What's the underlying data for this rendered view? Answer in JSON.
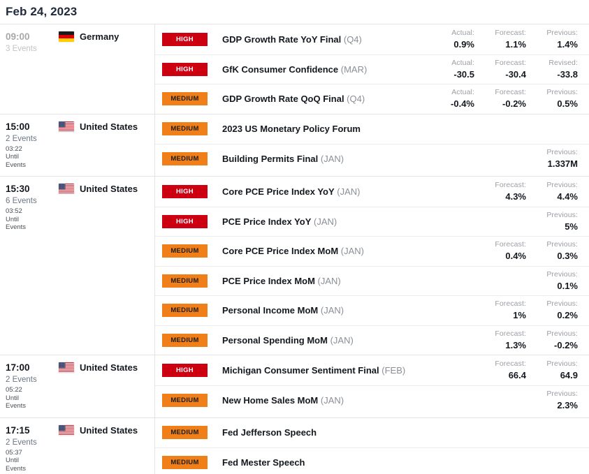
{
  "header": {
    "date_title": "Feb 24, 2023"
  },
  "colors": {
    "impact_high": "#cc0011",
    "impact_medium": "#f07f1a",
    "title": "#1f2a3c",
    "muted": "#9a9ea4"
  },
  "labels": {
    "actual": "Actual:",
    "forecast": "Forecast:",
    "previous": "Previous:",
    "revised": "Revised:",
    "until": "Until",
    "events_word": "Events"
  },
  "blocks": [
    {
      "time": "09:00",
      "events_count": "3 Events",
      "countdown": "",
      "past": true,
      "country": "Germany",
      "flag": "flag-germany",
      "rows": [
        {
          "impact": "HIGH",
          "impact_level": "high",
          "title": "GDP Growth Rate YoY Final",
          "period": "(Q4)",
          "cells": [
            {
              "label": "Actual:",
              "value": "0.9%"
            },
            {
              "label": "Forecast:",
              "value": "1.1%"
            },
            {
              "label": "Previous:",
              "value": "1.4%"
            }
          ]
        },
        {
          "impact": "HIGH",
          "impact_level": "high",
          "title": "GfK Consumer Confidence",
          "period": "(MAR)",
          "cells": [
            {
              "label": "Actual:",
              "value": "-30.5"
            },
            {
              "label": "Forecast:",
              "value": "-30.4"
            },
            {
              "label": "Revised:",
              "value": "-33.8"
            }
          ]
        },
        {
          "impact": "MEDIUM",
          "impact_level": "medium",
          "title": "GDP Growth Rate QoQ Final",
          "period": "(Q4)",
          "cells": [
            {
              "label": "Actual:",
              "value": "-0.4%"
            },
            {
              "label": "Forecast:",
              "value": "-0.2%"
            },
            {
              "label": "Previous:",
              "value": "0.5%"
            }
          ]
        }
      ]
    },
    {
      "time": "15:00",
      "events_count": "2 Events",
      "countdown": "03:22",
      "past": false,
      "country": "United States",
      "flag": "flag-united-states",
      "rows": [
        {
          "impact": "MEDIUM",
          "impact_level": "medium",
          "title": "2023 US Monetary Policy Forum",
          "period": "",
          "cells": [
            {
              "label": "",
              "value": ""
            },
            {
              "label": "",
              "value": ""
            },
            {
              "label": "",
              "value": ""
            }
          ]
        },
        {
          "impact": "MEDIUM",
          "impact_level": "medium",
          "title": "Building Permits Final",
          "period": "(JAN)",
          "cells": [
            {
              "label": "",
              "value": ""
            },
            {
              "label": "",
              "value": ""
            },
            {
              "label": "Previous:",
              "value": "1.337M"
            }
          ]
        }
      ]
    },
    {
      "time": "15:30",
      "events_count": "6 Events",
      "countdown": "03:52",
      "past": false,
      "country": "United States",
      "flag": "flag-united-states",
      "rows": [
        {
          "impact": "HIGH",
          "impact_level": "high",
          "title": "Core PCE Price Index YoY",
          "period": "(JAN)",
          "cells": [
            {
              "label": "",
              "value": ""
            },
            {
              "label": "Forecast:",
              "value": "4.3%"
            },
            {
              "label": "Previous:",
              "value": "4.4%"
            }
          ]
        },
        {
          "impact": "HIGH",
          "impact_level": "high",
          "title": "PCE Price Index YoY",
          "period": "(JAN)",
          "cells": [
            {
              "label": "",
              "value": ""
            },
            {
              "label": "",
              "value": ""
            },
            {
              "label": "Previous:",
              "value": "5%"
            }
          ]
        },
        {
          "impact": "MEDIUM",
          "impact_level": "medium",
          "title": "Core PCE Price Index MoM",
          "period": "(JAN)",
          "cells": [
            {
              "label": "",
              "value": ""
            },
            {
              "label": "Forecast:",
              "value": "0.4%"
            },
            {
              "label": "Previous:",
              "value": "0.3%"
            }
          ]
        },
        {
          "impact": "MEDIUM",
          "impact_level": "medium",
          "title": "PCE Price Index MoM",
          "period": "(JAN)",
          "cells": [
            {
              "label": "",
              "value": ""
            },
            {
              "label": "",
              "value": ""
            },
            {
              "label": "Previous:",
              "value": "0.1%"
            }
          ]
        },
        {
          "impact": "MEDIUM",
          "impact_level": "medium",
          "title": "Personal Income MoM",
          "period": "(JAN)",
          "cells": [
            {
              "label": "",
              "value": ""
            },
            {
              "label": "Forecast:",
              "value": "1%"
            },
            {
              "label": "Previous:",
              "value": "0.2%"
            }
          ]
        },
        {
          "impact": "MEDIUM",
          "impact_level": "medium",
          "title": "Personal Spending MoM",
          "period": "(JAN)",
          "cells": [
            {
              "label": "",
              "value": ""
            },
            {
              "label": "Forecast:",
              "value": "1.3%"
            },
            {
              "label": "Previous:",
              "value": "-0.2%"
            }
          ]
        }
      ]
    },
    {
      "time": "17:00",
      "events_count": "2 Events",
      "countdown": "05:22",
      "past": false,
      "country": "United States",
      "flag": "flag-united-states",
      "rows": [
        {
          "impact": "HIGH",
          "impact_level": "high",
          "title": "Michigan Consumer Sentiment Final",
          "period": "(FEB)",
          "cells": [
            {
              "label": "",
              "value": ""
            },
            {
              "label": "Forecast:",
              "value": "66.4"
            },
            {
              "label": "Previous:",
              "value": "64.9"
            }
          ]
        },
        {
          "impact": "MEDIUM",
          "impact_level": "medium",
          "title": "New Home Sales MoM",
          "period": "(JAN)",
          "cells": [
            {
              "label": "",
              "value": ""
            },
            {
              "label": "",
              "value": ""
            },
            {
              "label": "Previous:",
              "value": "2.3%"
            }
          ]
        }
      ]
    },
    {
      "time": "17:15",
      "events_count": "2 Events",
      "countdown": "05:37",
      "past": false,
      "country": "United States",
      "flag": "flag-united-states",
      "rows": [
        {
          "impact": "MEDIUM",
          "impact_level": "medium",
          "title": "Fed Jefferson Speech",
          "period": "",
          "cells": [
            {
              "label": "",
              "value": ""
            },
            {
              "label": "",
              "value": ""
            },
            {
              "label": "",
              "value": ""
            }
          ]
        },
        {
          "impact": "MEDIUM",
          "impact_level": "medium",
          "title": "Fed Mester Speech",
          "period": "",
          "cells": [
            {
              "label": "",
              "value": ""
            },
            {
              "label": "",
              "value": ""
            },
            {
              "label": "",
              "value": ""
            }
          ]
        }
      ]
    }
  ]
}
